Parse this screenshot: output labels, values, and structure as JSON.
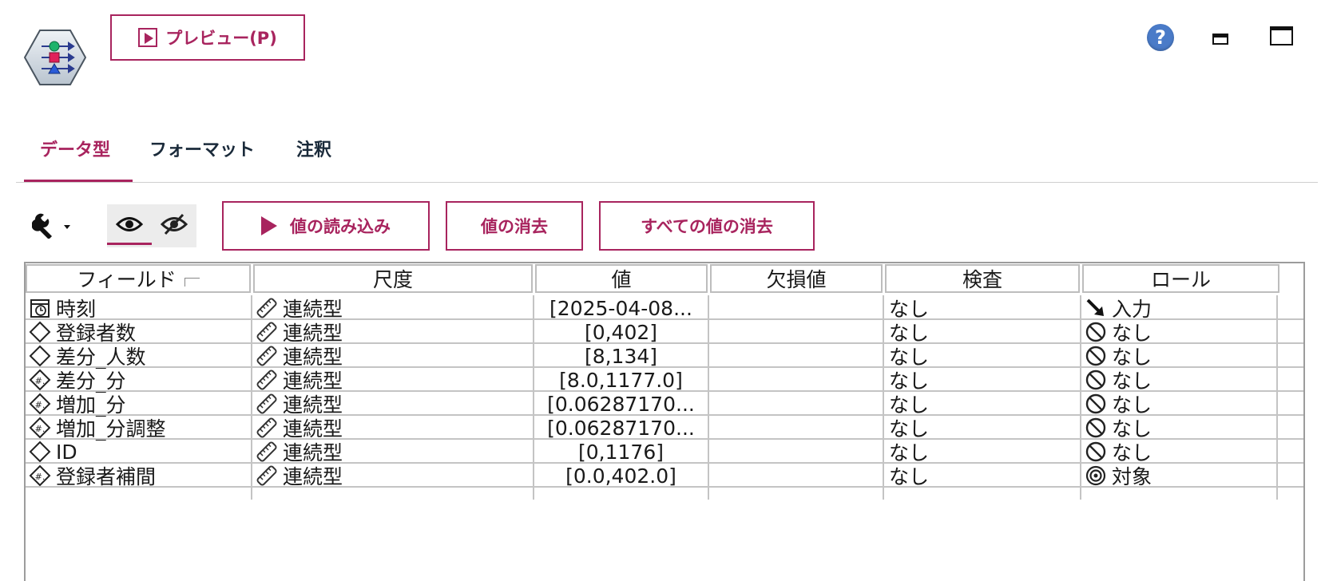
{
  "header": {
    "preview_label": "プレビュー(P)",
    "help_glyph": "?"
  },
  "tabs": [
    {
      "label": "データ型",
      "active": true
    },
    {
      "label": "フォーマット"
    },
    {
      "label": "注釈"
    }
  ],
  "toolbar": {
    "read_values_label": "値の読み込み",
    "clear_values_label": "値の消去",
    "clear_all_values_label": "すべての値の消去"
  },
  "colors": {
    "accent": "#a8245e",
    "help": "#4a7bc8"
  },
  "table": {
    "columns": [
      "フィールド",
      "尺度",
      "値",
      "欠損値",
      "検査",
      "ロール"
    ],
    "rows": [
      {
        "field": "時刻",
        "field_icon": "timestamp-icon",
        "measure": "連続型",
        "measure_icon": "ruler-icon",
        "values": "[2025-04-08...",
        "missing": "",
        "check": "なし",
        "role": "入力",
        "role_icon": "input-arrow-icon"
      },
      {
        "field": "登録者数",
        "field_icon": "integer-icon",
        "measure": "連続型",
        "measure_icon": "ruler-icon",
        "values": "[0,402]",
        "missing": "",
        "check": "なし",
        "role": "なし",
        "role_icon": "none-icon"
      },
      {
        "field": "差分_人数",
        "field_icon": "integer-icon",
        "measure": "連続型",
        "measure_icon": "ruler-icon",
        "values": "[8,134]",
        "missing": "",
        "check": "なし",
        "role": "なし",
        "role_icon": "none-icon"
      },
      {
        "field": "差分_分",
        "field_icon": "real-icon",
        "measure": "連続型",
        "measure_icon": "ruler-icon",
        "values": "[8.0,1177.0]",
        "missing": "",
        "check": "なし",
        "role": "なし",
        "role_icon": "none-icon"
      },
      {
        "field": "増加_分",
        "field_icon": "real-icon",
        "measure": "連続型",
        "measure_icon": "ruler-icon",
        "values": "[0.06287170...",
        "missing": "",
        "check": "なし",
        "role": "なし",
        "role_icon": "none-icon"
      },
      {
        "field": "増加_分調整",
        "field_icon": "real-icon",
        "measure": "連続型",
        "measure_icon": "ruler-icon",
        "values": "[0.06287170...",
        "missing": "",
        "check": "なし",
        "role": "なし",
        "role_icon": "none-icon"
      },
      {
        "field": "ID",
        "field_icon": "integer-icon",
        "measure": "連続型",
        "measure_icon": "ruler-icon",
        "values": "[0,1176]",
        "missing": "",
        "check": "なし",
        "role": "なし",
        "role_icon": "none-icon"
      },
      {
        "field": "登録者補間",
        "field_icon": "real-icon",
        "measure": "連続型",
        "measure_icon": "ruler-icon",
        "values": "[0.0,402.0]",
        "missing": "",
        "check": "なし",
        "role": "対象",
        "role_icon": "target-icon"
      }
    ]
  }
}
